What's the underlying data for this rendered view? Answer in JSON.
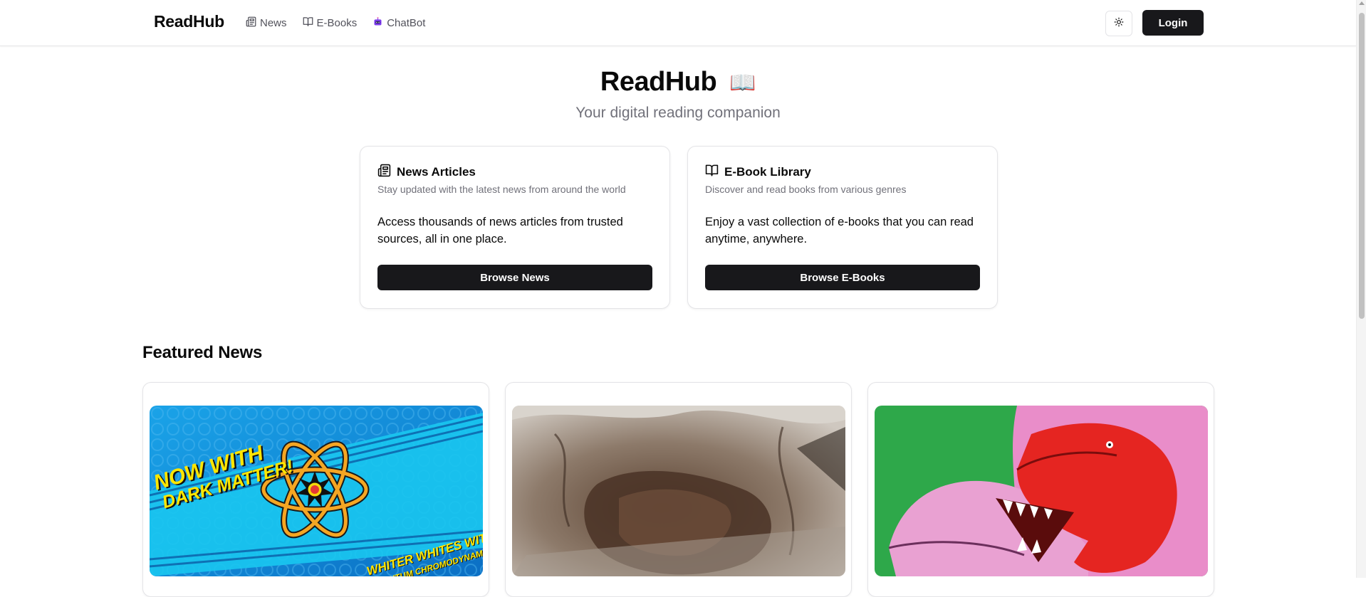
{
  "nav": {
    "brand": "ReadHub",
    "links": [
      {
        "label": "News",
        "icon": "newspaper-icon"
      },
      {
        "label": "E-Books",
        "icon": "book-open-icon"
      },
      {
        "label": "ChatBot",
        "icon": "robot-icon"
      }
    ],
    "theme_toggle_icon": "sun-icon",
    "login_label": "Login"
  },
  "hero": {
    "title": "ReadHub",
    "title_emoji": "📖",
    "subtitle": "Your digital reading companion"
  },
  "features": [
    {
      "title": "News Articles",
      "icon": "newspaper-icon",
      "description": "Stay updated with the latest news from around the world",
      "body": "Access thousands of news articles from trusted sources, all in one place.",
      "button": "Browse News"
    },
    {
      "title": "E-Book Library",
      "icon": "book-open-icon",
      "description": "Discover and read books from various genres",
      "body": "Enjoy a vast collection of e-books that you can read anytime, anywhere.",
      "button": "Browse E-Books"
    }
  ],
  "featured_news": {
    "title": "Featured News",
    "cards": [
      {
        "image_text_1": "NOW WITH",
        "image_text_2": "DARK MATTER!",
        "image_text_3": "WHITER WHITES WITH",
        "image_text_4": "QUANTUM CHROMODYNAMICS"
      },
      {},
      {}
    ]
  },
  "colors": {
    "primary": "#18181b",
    "muted": "#71717a",
    "border": "#e4e4e7"
  }
}
